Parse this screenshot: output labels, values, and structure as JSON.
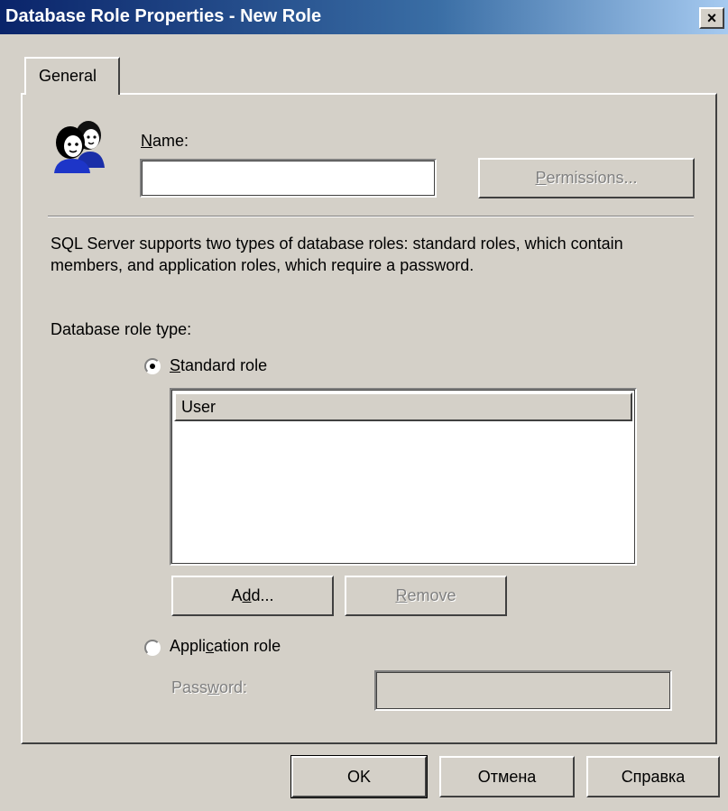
{
  "window": {
    "title": "Database Role Properties - New Role",
    "close_label": "×"
  },
  "tabs": [
    {
      "label": "General",
      "selected": true
    }
  ],
  "name_section": {
    "label_first": "N",
    "label_rest": "ame:",
    "value": "",
    "permissions_pre": "",
    "permissions_key": "P",
    "permissions_rest": "ermissions..."
  },
  "description": "SQL Server supports two types of database roles: standard roles, which contain members, and application roles, which require a password.",
  "role_type": {
    "label": "Database role type:",
    "standard": {
      "key": "S",
      "rest": "tandard role",
      "selected": true
    },
    "members_column": "User",
    "members": [],
    "add_pre": "A",
    "add_key": "d",
    "add_rest": "d...",
    "remove_key": "R",
    "remove_rest": "emove",
    "application": {
      "pre": "Appli",
      "key": "c",
      "rest": "ation role",
      "selected": false
    },
    "password_pre": "Pass",
    "password_key": "w",
    "password_rest": "ord:",
    "password_value": ""
  },
  "footer": {
    "ok": "OK",
    "cancel": "Отмена",
    "help": "Справка"
  }
}
